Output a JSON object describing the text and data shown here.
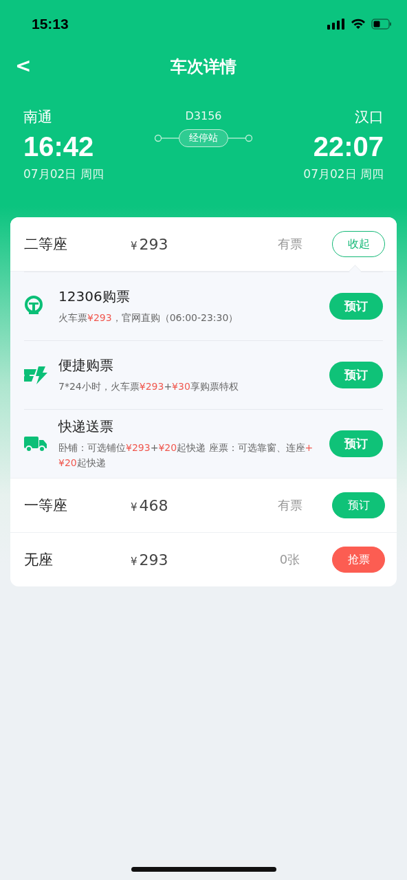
{
  "status_bar": {
    "time": "15:13"
  },
  "nav": {
    "back": "<",
    "title": "车次详情"
  },
  "route": {
    "from": {
      "station": "南通",
      "time": "16:42",
      "date": "07月02日 周四"
    },
    "train": "D3156",
    "stops_button": "经停站",
    "to": {
      "station": "汉口",
      "time": "22:07",
      "date": "07月02日 周四"
    }
  },
  "seats": [
    {
      "name": "二等座",
      "currency": "¥",
      "price": "293",
      "availability": "有票",
      "action": {
        "label": "收起",
        "kind": "outline"
      },
      "expanded": true,
      "options": [
        {
          "kind": "rail",
          "title": "12306购票",
          "description": [
            {
              "text": "火车票",
              "highlight": false
            },
            {
              "text": "¥293",
              "highlight": true
            },
            {
              "text": "，官网直购（06:00-23:30）",
              "highlight": false
            }
          ],
          "button": "预订"
        },
        {
          "kind": "lightning",
          "title": "便捷购票",
          "description": [
            {
              "text": "7*24小时，火车票",
              "highlight": false
            },
            {
              "text": "¥293",
              "highlight": true
            },
            {
              "text": "+",
              "highlight": false
            },
            {
              "text": "¥30",
              "highlight": true
            },
            {
              "text": "享购票特权",
              "highlight": false
            }
          ],
          "button": "预订"
        },
        {
          "kind": "truck",
          "title": "快递送票",
          "description": [
            {
              "text": "卧铺：可选铺位",
              "highlight": false
            },
            {
              "text": "¥293",
              "highlight": true
            },
            {
              "text": "+",
              "highlight": false
            },
            {
              "text": "¥20",
              "highlight": true
            },
            {
              "text": "起快递 座票：可选靠窗、连座",
              "highlight": false
            },
            {
              "text": "+¥20",
              "highlight": true
            },
            {
              "text": "起快递",
              "highlight": false
            }
          ],
          "button": "预订"
        }
      ]
    },
    {
      "name": "一等座",
      "currency": "¥",
      "price": "468",
      "availability": "有票",
      "action": {
        "label": "预订",
        "kind": "book"
      },
      "expanded": false
    },
    {
      "name": "无座",
      "currency": "¥",
      "price": "293",
      "availability": "0张",
      "action": {
        "label": "抢票",
        "kind": "grab"
      },
      "expanded": false
    }
  ]
}
